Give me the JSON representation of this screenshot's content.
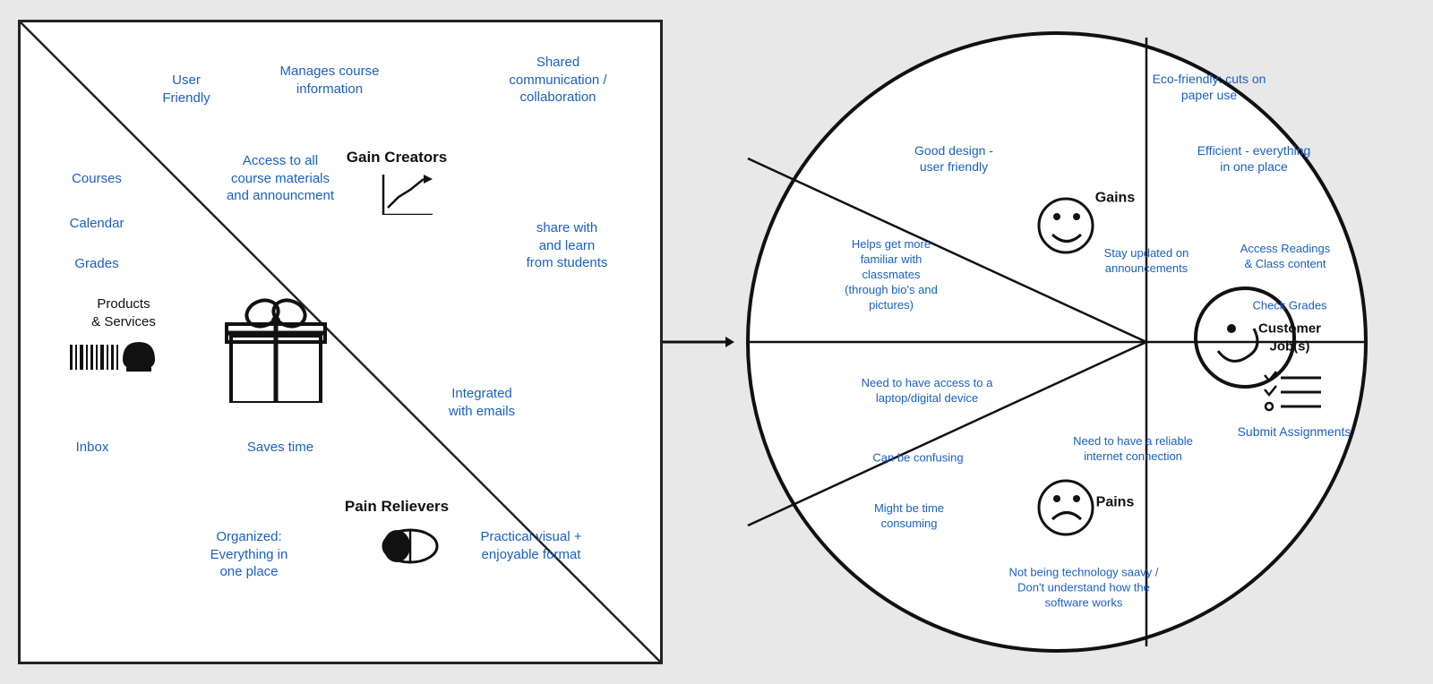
{
  "left": {
    "title_gain": "Gain Creators",
    "title_pain": "Pain Relievers",
    "labels": [
      {
        "id": "user-friendly",
        "text": "User\nFriendly",
        "color": "blue"
      },
      {
        "id": "manages-course",
        "text": "Manages course\ninformation",
        "color": "blue"
      },
      {
        "id": "shared-comm",
        "text": "Shared\ncommunication /\ncollaboration",
        "color": "blue"
      },
      {
        "id": "access-all",
        "text": "Access to all\ncourse materials\nand announcment",
        "color": "blue"
      },
      {
        "id": "share-with",
        "text": "share with\nand learn\nfrom students",
        "color": "blue"
      },
      {
        "id": "courses",
        "text": "Courses",
        "color": "blue"
      },
      {
        "id": "calendar",
        "text": "Calendar",
        "color": "blue"
      },
      {
        "id": "grades",
        "text": "Grades",
        "color": "blue"
      },
      {
        "id": "products-services",
        "text": "Products\n& Services",
        "color": "black"
      },
      {
        "id": "inbox",
        "text": "Inbox",
        "color": "blue"
      },
      {
        "id": "integrated",
        "text": "Integrated\nwith emails",
        "color": "blue"
      },
      {
        "id": "saves-time",
        "text": "Saves time",
        "color": "blue"
      },
      {
        "id": "organized",
        "text": "Organized:\nEverything in\none place",
        "color": "blue"
      },
      {
        "id": "practical-visual",
        "text": "Practical visual +\nenjoyable format",
        "color": "blue"
      }
    ]
  },
  "right": {
    "gains_label": "Gains",
    "pains_label": "Pains",
    "customer_jobs_label": "Customer\nJob(s)",
    "labels": [
      {
        "id": "eco-friendly",
        "text": "Eco-friendly: cuts on\npaper use",
        "color": "blue"
      },
      {
        "id": "good-design",
        "text": "Good design -\nuser friendly",
        "color": "blue"
      },
      {
        "id": "efficient",
        "text": "Efficient - everything\nin one place",
        "color": "blue"
      },
      {
        "id": "helps-get-familiar",
        "text": "Helps get more\nfamiliar with\nclassmates\n(through bio's and\npictures)",
        "color": "blue"
      },
      {
        "id": "stay-updated",
        "text": "Stay updated on\nannouncements",
        "color": "blue"
      },
      {
        "id": "access-readings",
        "text": "Access Readings\n& Class content",
        "color": "blue"
      },
      {
        "id": "check-grades",
        "text": "Check Grades",
        "color": "blue"
      },
      {
        "id": "need-access-laptop",
        "text": "Need to have access to a\nlaptop/digital device",
        "color": "blue"
      },
      {
        "id": "can-be-confusing",
        "text": "Can be confusing",
        "color": "blue"
      },
      {
        "id": "need-reliable-internet",
        "text": "Need to have a reliable\ninternet connection",
        "color": "blue"
      },
      {
        "id": "might-time-consuming",
        "text": "Might be time\nconsuming",
        "color": "blue"
      },
      {
        "id": "not-technology-savvy",
        "text": "Not being technology saavy /\nDon't understand how the\nsoftware works",
        "color": "blue"
      },
      {
        "id": "submit-assignments",
        "text": "Submit Assignments",
        "color": "blue"
      }
    ]
  }
}
